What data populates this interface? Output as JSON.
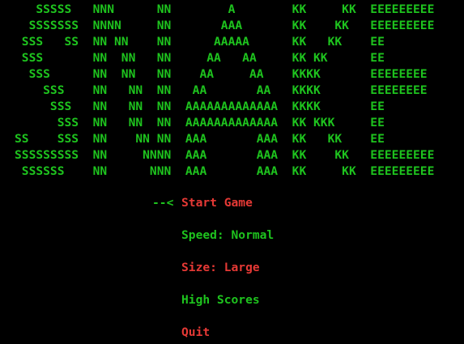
{
  "title_art": {
    "color": "#1ec31e",
    "lines": [
      "   SSSSS   NNN      NN        A        KK     KK  EEEEEEEEE",
      "  SSSSSSS  NNNN     NN       AAA       KK    KK   EEEEEEEEE",
      " SSS   SS  NN NN    NN      AAAAA      KK   KK    EE",
      " SSS       NN  NN   NN     AA   AA     KK KK      EE",
      "  SSS      NN  NN   NN    AA     AA    KKKK       EEEEEEEE",
      "    SSS    NN   NN  NN   AA       AA   KKKK       EEEEEEEE",
      "     SSS   NN   NN  NN  AAAAAAAAAAAAA  KKKK       EE",
      "      SSS  NN   NN  NN  AAAAAAAAAAAAA  KK KKK     EE",
      "SS    SSS  NN    NN NN  AAA       AAA  KK   KK    EE",
      "SSSSSSSSS  NN     NNNN  AAA       AAA  KK    KK   EEEEEEEEE",
      " SSSSSS    NN      NNN  AAA       AAA  KK     KK  EEEEEEEEE"
    ]
  },
  "menu": {
    "cursor": "--<",
    "colors": {
      "selected": "#e53935",
      "normal": "#1ec31e"
    },
    "items": [
      {
        "label": "Start Game",
        "color": "#e53935"
      },
      {
        "label": "Speed: Normal",
        "color": "#1ec31e"
      },
      {
        "label": "Size: Large",
        "color": "#e53935"
      },
      {
        "label": "High Scores",
        "color": "#1ec31e"
      },
      {
        "label": "Quit",
        "color": "#e53935"
      }
    ]
  }
}
